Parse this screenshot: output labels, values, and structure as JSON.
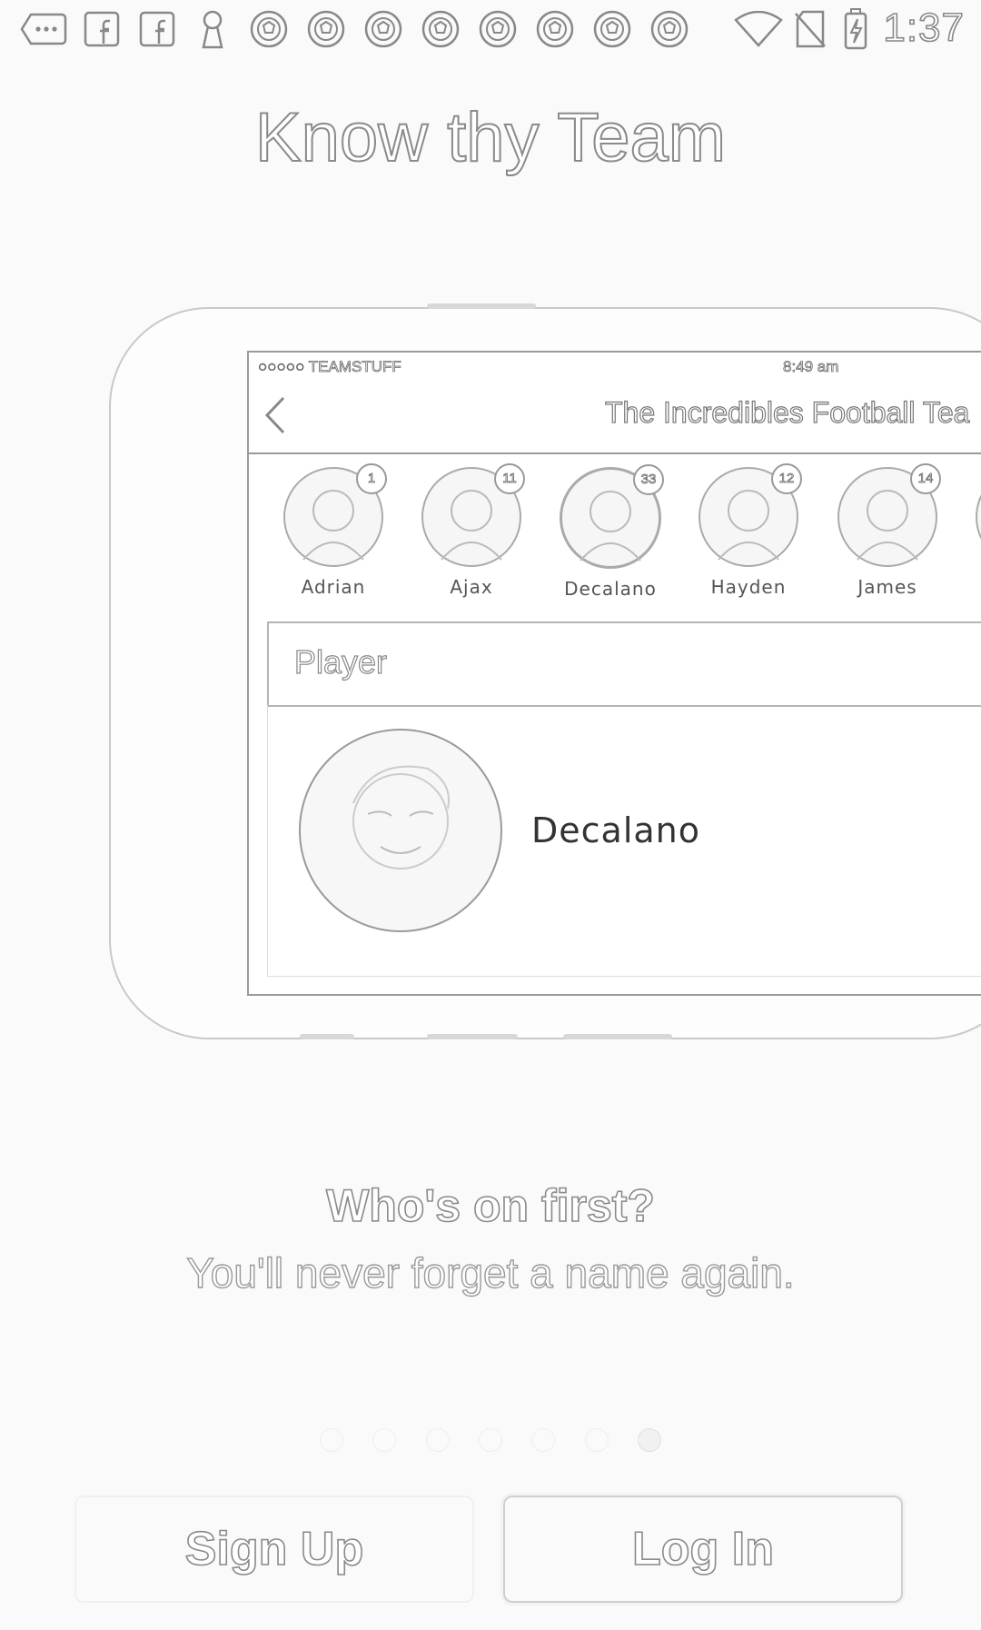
{
  "status_bar": {
    "time": "1:37",
    "icons": [
      "more-dots-icon",
      "facebook-icon",
      "facebook-icon",
      "keyhole-icon",
      "soccer-ball-icon",
      "soccer-ball-icon",
      "soccer-ball-icon",
      "soccer-ball-icon",
      "soccer-ball-icon",
      "soccer-ball-icon",
      "soccer-ball-icon",
      "soccer-ball-icon",
      "wifi-icon",
      "no-sim-icon",
      "battery-charging-icon"
    ]
  },
  "headline": "Know thy Team",
  "mock_app": {
    "carrier": "○○○○○ TEAMSTUFF",
    "time": "8:49 am",
    "nav_title": "The Incredibles Football Tea",
    "players": [
      {
        "name": "Adrian",
        "number": "1"
      },
      {
        "name": "Ajax",
        "number": "11"
      },
      {
        "name": "Decalano",
        "number": "33"
      },
      {
        "name": "Hayden",
        "number": "12"
      },
      {
        "name": "James",
        "number": "14"
      }
    ],
    "section_header": "Player",
    "selected_player": "Decalano"
  },
  "subtitle": "Who's on first?",
  "tagline": "You'll never forget a name again.",
  "pager": {
    "count": 7,
    "active_index": 6
  },
  "buttons": {
    "sign_up": "Sign Up",
    "log_in": "Log In"
  }
}
